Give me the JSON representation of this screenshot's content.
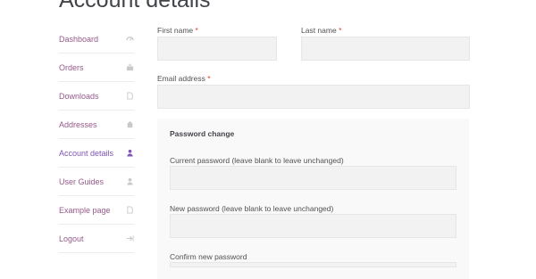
{
  "page": {
    "title": "Account details"
  },
  "sidebar": {
    "items": [
      {
        "label": "Dashboard",
        "icon": "dashboard-icon",
        "active": false
      },
      {
        "label": "Orders",
        "icon": "basket-icon",
        "active": false
      },
      {
        "label": "Downloads",
        "icon": "file-icon",
        "active": false
      },
      {
        "label": "Addresses",
        "icon": "home-icon",
        "active": false
      },
      {
        "label": "Account details",
        "icon": "user-icon",
        "active": true
      },
      {
        "label": "User Guides",
        "icon": "user-icon",
        "active": false
      },
      {
        "label": "Example page",
        "icon": "file-icon",
        "active": false
      },
      {
        "label": "Logout",
        "icon": "sign-out-icon",
        "active": false
      }
    ]
  },
  "form": {
    "first_name_label": "First name",
    "last_name_label": "Last name",
    "email_label": "Email address",
    "required_marker": "*",
    "first_name_value": "",
    "last_name_value": "",
    "email_value": ""
  },
  "password": {
    "legend": "Password change",
    "current_label": "Current password (leave blank to leave unchanged)",
    "new_label": "New password (leave blank to leave unchanged)",
    "confirm_label": "Confirm new password"
  },
  "colors": {
    "link": "#96588a",
    "active": "#7f54b3",
    "required": "#e2401c",
    "input_bg": "#f2f2f2"
  }
}
